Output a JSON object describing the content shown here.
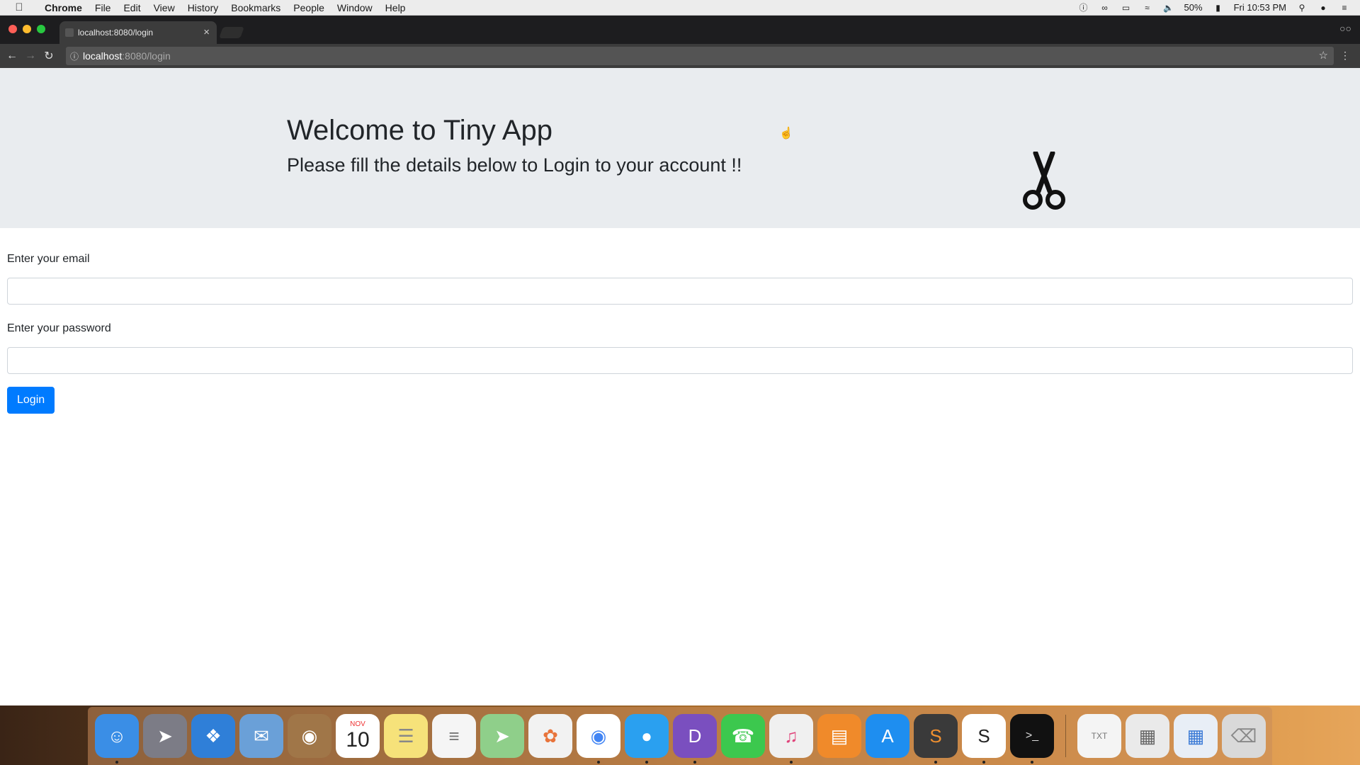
{
  "menubar": {
    "app": "Chrome",
    "items": [
      "File",
      "Edit",
      "View",
      "History",
      "Bookmarks",
      "People",
      "Window",
      "Help"
    ],
    "battery": "50%",
    "clock": "Fri 10:53 PM"
  },
  "browser": {
    "tab_title": "localhost:8080/login",
    "url_host": "localhost",
    "url_path": ":8080/login"
  },
  "page": {
    "title": "Welcome to Tiny App",
    "subtitle": "Please fill the details below to Login to your account !!",
    "email_label": "Enter your email",
    "email_value": "",
    "password_label": "Enter your password",
    "password_value": "",
    "login_button": "Login",
    "logo_icon": "scissors-icon"
  },
  "dock": {
    "calendar_month": "NOV",
    "calendar_day": "10",
    "items": [
      "finder",
      "launchpad",
      "safari",
      "mail",
      "contacts",
      "calendar",
      "notes",
      "reminders",
      "maps",
      "photos",
      "chrome",
      "messages",
      "dash",
      "facetime",
      "itunes",
      "ibooks",
      "app-store",
      "sublime-text",
      "slack",
      "terminal",
      "text-file",
      "document",
      "screenshots",
      "trash"
    ]
  }
}
